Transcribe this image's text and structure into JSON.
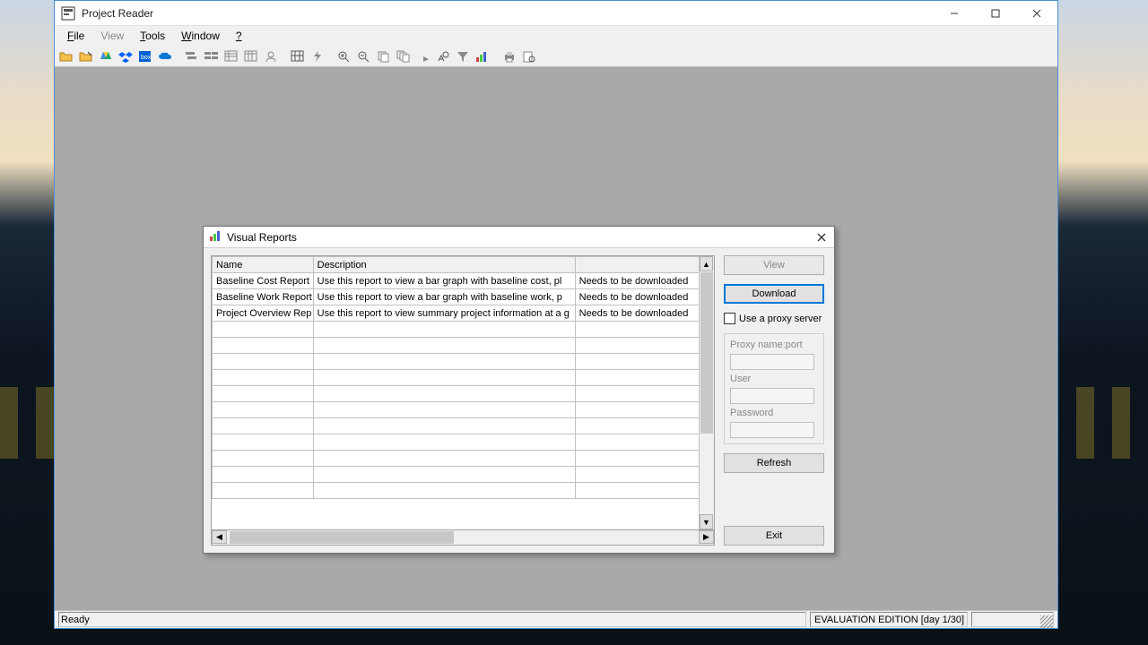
{
  "app": {
    "title": "Project Reader",
    "status_left": "Ready",
    "status_right": "EVALUATION EDITION  [day 1/30]"
  },
  "menu": {
    "file": "File",
    "view": "View",
    "tools": "Tools",
    "window": "Window",
    "help": "?"
  },
  "dialog": {
    "title": "Visual Reports",
    "columns": {
      "name": "Name",
      "desc": "Description",
      "status": ""
    },
    "rows": [
      {
        "name": "Baseline Cost Report",
        "desc": "Use this report to view a bar graph with baseline cost, pl",
        "status": "Needs to be downloaded"
      },
      {
        "name": "Baseline Work Report",
        "desc": "Use this report to view a bar graph with baseline work, p",
        "status": "Needs to be downloaded"
      },
      {
        "name": "Project Overview Rep",
        "desc": "Use this report to view summary project information at a g",
        "status": "Needs to be downloaded"
      }
    ],
    "buttons": {
      "view": "View",
      "download": "Download",
      "refresh": "Refresh",
      "exit": "Exit"
    },
    "proxy": {
      "use_label": "Use a proxy server",
      "name_label": "Proxy name:port",
      "user_label": "User",
      "pass_label": "Password",
      "name_value": "",
      "user_value": "",
      "pass_value": ""
    }
  }
}
